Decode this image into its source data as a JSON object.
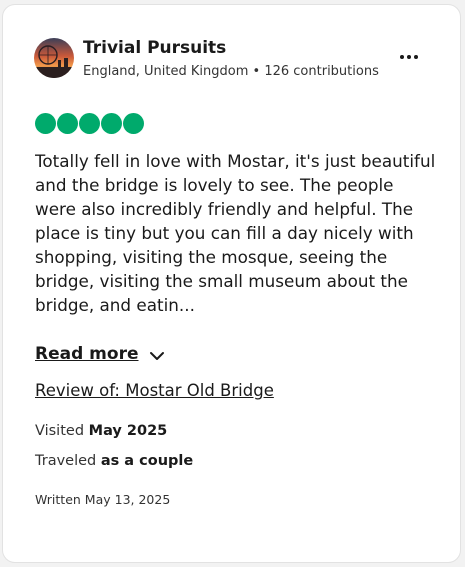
{
  "author": {
    "name": "Trivial Pursuits",
    "location": "England, United Kingdom",
    "separator": "•",
    "contributions": "126 contributions"
  },
  "rating": {
    "value": 5,
    "max": 5,
    "color": "#00aa6c"
  },
  "review": {
    "text": "Totally fell in love with Mostar, it's just beautiful and the bridge is lovely to see. The people were also incredibly friendly and helpful. The place is tiny but you can fill a day nicely with shopping, visiting the mosque, seeing the bridge, visiting the small museum about the bridge, and eatin...",
    "read_more_label": "Read more",
    "review_of_label": "Review of: Mostar Old Bridge"
  },
  "details": {
    "visited_prefix": "Visited",
    "visited_value": "May 2025",
    "traveled_prefix": "Traveled",
    "traveled_value": "as a couple",
    "written": "Written May 13, 2025"
  },
  "icons": {
    "more": "more-options-icon",
    "chevron": "chevron-down-icon",
    "avatar": "avatar"
  }
}
